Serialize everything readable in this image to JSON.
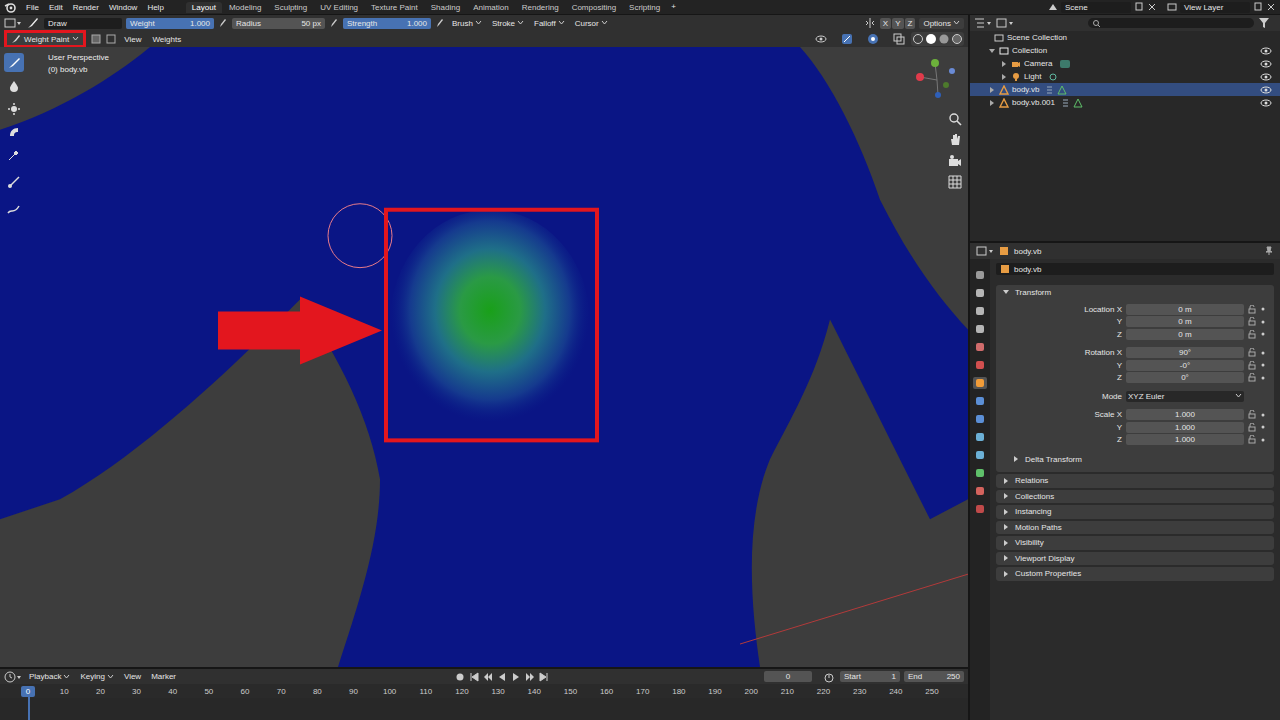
{
  "menu": [
    "File",
    "Edit",
    "Render",
    "Window",
    "Help"
  ],
  "workspaces": [
    {
      "label": "Layout",
      "selected": true
    },
    {
      "label": "Modeling",
      "selected": false
    },
    {
      "label": "Sculpting",
      "selected": false
    },
    {
      "label": "UV Editing",
      "selected": false
    },
    {
      "label": "Texture Paint",
      "selected": false
    },
    {
      "label": "Shading",
      "selected": false
    },
    {
      "label": "Animation",
      "selected": false
    },
    {
      "label": "Rendering",
      "selected": false
    },
    {
      "label": "Compositing",
      "selected": false
    },
    {
      "label": "Scripting",
      "selected": false
    }
  ],
  "add_workspace": "+",
  "scene": "Scene",
  "view_layer": "View Layer",
  "tool_header": {
    "tool": "Draw",
    "sliders": [
      {
        "label": "Weight",
        "value": "1.000",
        "level": 1,
        "kind": "slider"
      },
      {
        "label": "Radius",
        "value": "50 px",
        "level": 0,
        "kind": "number"
      },
      {
        "label": "Strength",
        "value": "1.000",
        "level": 1,
        "kind": "slider"
      }
    ],
    "menus": [
      "Brush",
      "Stroke",
      "Falloff",
      "Cursor"
    ],
    "axes": [
      {
        "label": "X",
        "on": false
      },
      {
        "label": "Y",
        "on": false
      },
      {
        "label": "Z",
        "on": false
      }
    ],
    "options": "Options"
  },
  "viewport": {
    "mode": "Weight Paint",
    "menus": [
      "View",
      "Weights"
    ],
    "overlay_text": [
      "User Perspective",
      "(0) body.vb"
    ]
  },
  "outliner": {
    "root": "Scene Collection",
    "items": [
      {
        "label": "Collection",
        "kind": "collection",
        "depth": 1,
        "selected": false,
        "visible": true
      },
      {
        "label": "Camera",
        "kind": "camera",
        "depth": 2,
        "selected": false,
        "visible": true
      },
      {
        "label": "Light",
        "kind": "light",
        "depth": 2,
        "selected": false,
        "visible": true
      },
      {
        "label": "body.vb",
        "kind": "mesh",
        "depth": 1,
        "selected": true,
        "visible": true
      },
      {
        "label": "body.vb.001",
        "kind": "mesh",
        "depth": 1,
        "selected": false,
        "visible": true
      }
    ]
  },
  "properties": {
    "object": "body.vb",
    "object_field": "body.vb",
    "section": "Transform",
    "groups": [
      {
        "fields": [
          {
            "label": "Location X",
            "value": "0 m"
          },
          {
            "label": "Y",
            "value": "0 m"
          },
          {
            "label": "Z",
            "value": "0 m"
          }
        ]
      },
      {
        "fields": [
          {
            "label": "Rotation X",
            "value": "90°"
          },
          {
            "label": "Y",
            "value": "-0°"
          },
          {
            "label": "Z",
            "value": "0°"
          }
        ]
      },
      {
        "fields": [
          {
            "label": "Mode",
            "value": "XYZ Euler",
            "kind": "dropdown"
          }
        ]
      },
      {
        "fields": [
          {
            "label": "Scale X",
            "value": "1.000"
          },
          {
            "label": "Y",
            "value": "1.000"
          },
          {
            "label": "Z",
            "value": "1.000"
          }
        ]
      }
    ],
    "subpanels": [
      "Delta Transform"
    ],
    "panels": [
      "Relations",
      "Collections",
      "Instancing",
      "Motion Paths",
      "Visibility",
      "Viewport Display",
      "Custom Properties"
    ]
  },
  "timeline": {
    "menus": [
      "Playback",
      "Keying",
      "View",
      "Marker"
    ],
    "current_frame": "0",
    "start": {
      "label": "Start",
      "value": "1"
    },
    "end": {
      "label": "End",
      "value": "250"
    },
    "ruler": [
      "0",
      "10",
      "20",
      "30",
      "40",
      "50",
      "60",
      "70",
      "80",
      "90",
      "100",
      "110",
      "120",
      "130",
      "140",
      "150",
      "160",
      "170",
      "180",
      "190",
      "200",
      "210",
      "220",
      "230",
      "240",
      "250"
    ]
  }
}
